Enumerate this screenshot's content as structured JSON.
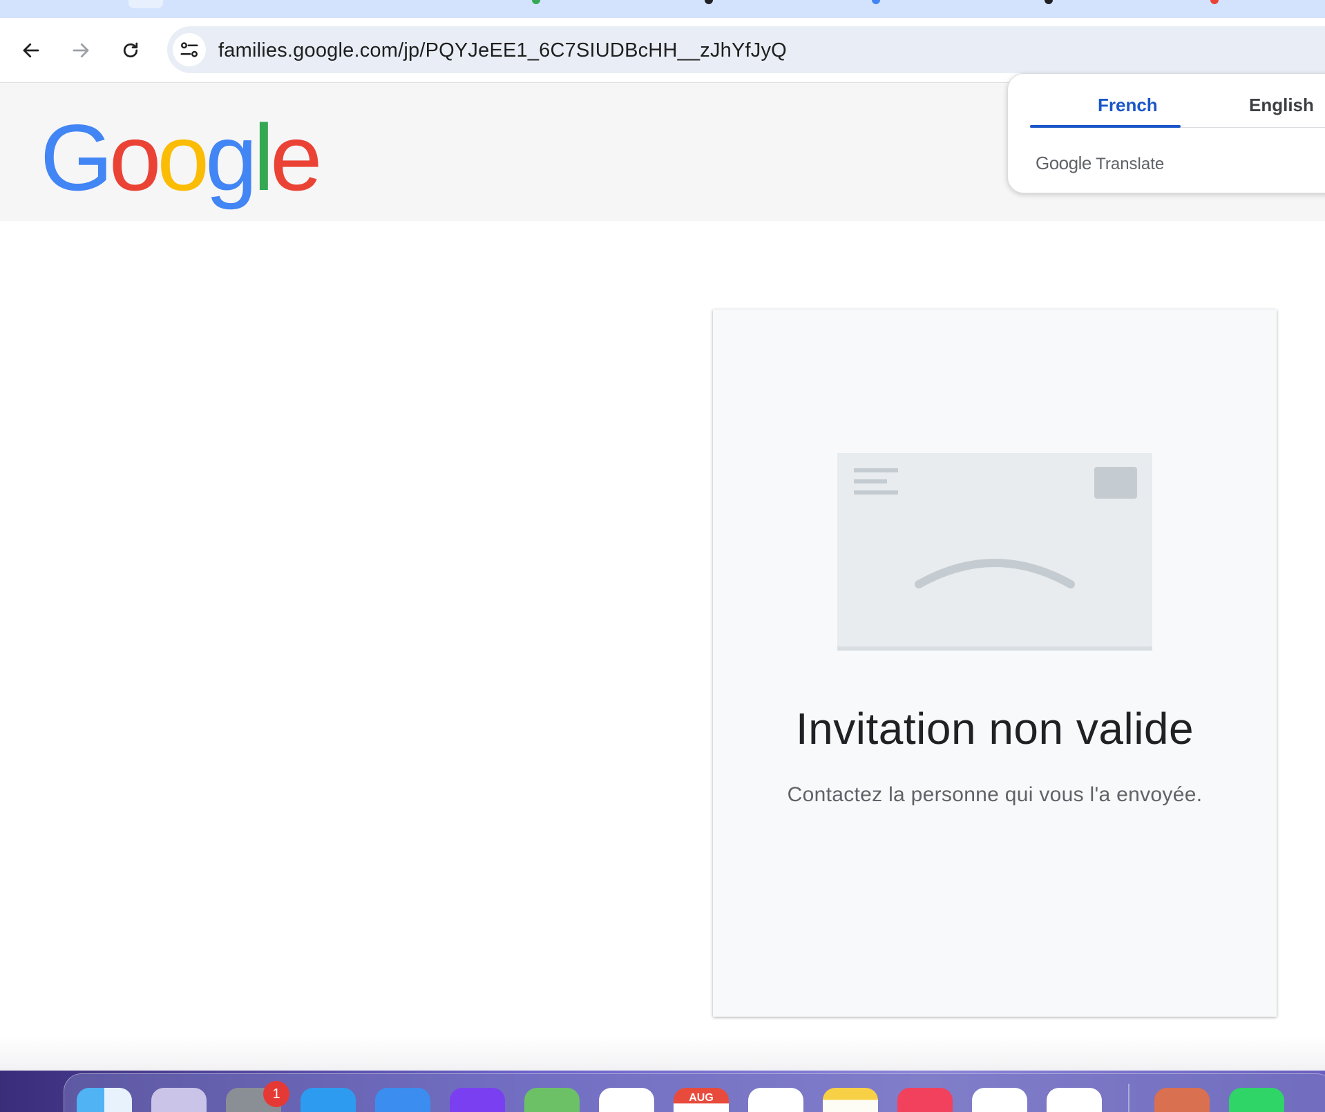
{
  "browser": {
    "url": "families.google.com/jp/PQYJeEE1_6C7SIUDBcHH__zJhYfJyQ",
    "icons": [
      "back-arrow-icon",
      "forward-arrow-icon",
      "reload-icon",
      "site-info-icon"
    ]
  },
  "header": {
    "logo_letters": [
      "G",
      "o",
      "o",
      "g",
      "l",
      "e"
    ],
    "logo_colors": [
      "#4285f4",
      "#ea4335",
      "#fbbc05",
      "#4285f4",
      "#34a853",
      "#ea4335"
    ]
  },
  "translate": {
    "source_language": "French",
    "target_language": "English",
    "brand_google": "Google",
    "brand_product": "Translate",
    "accent_color": "#1a56c8"
  },
  "card": {
    "title": "Invitation non valide",
    "subtitle": "Contactez la personne qui vous l'a envoyée.",
    "illustration": "sad-envelope-icon"
  },
  "dock": {
    "settings_badge": "1",
    "calendar_month": "AUG"
  }
}
